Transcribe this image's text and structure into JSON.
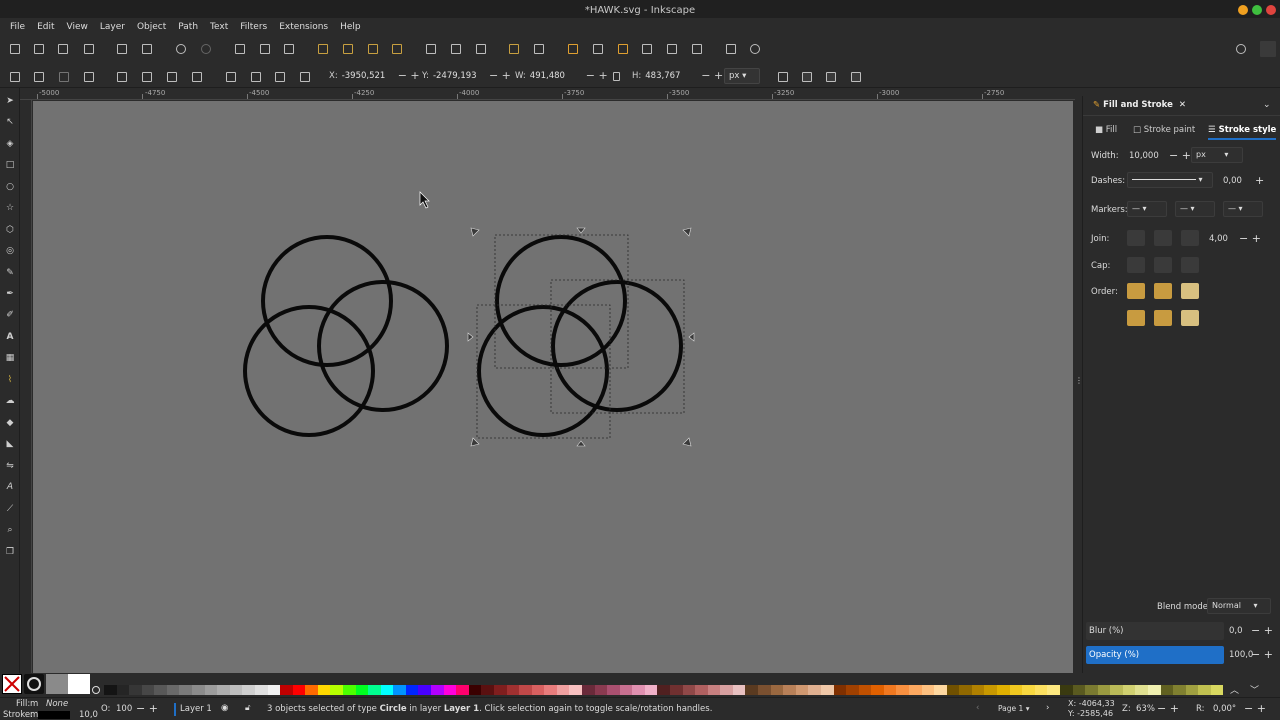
{
  "window": {
    "title": "*HAWK.svg - Inkscape"
  },
  "menu": [
    "File",
    "Edit",
    "View",
    "Layer",
    "Object",
    "Path",
    "Text",
    "Filters",
    "Extensions",
    "Help"
  ],
  "controls": {
    "x_label": "X:",
    "x_value": "-3950,521",
    "y_label": "Y:",
    "y_value": "-2479,193",
    "w_label": "W:",
    "w_value": "491,480",
    "h_label": "H:",
    "h_value": "483,767",
    "unit": "px"
  },
  "ruler": {
    "labels": [
      "-5000",
      "-4750",
      "-4500",
      "-4250",
      "-4000",
      "-3750",
      "-3500",
      "-3250",
      "-3000",
      "-2750"
    ]
  },
  "dock": {
    "panel_title": "Fill and Stroke",
    "tabs": [
      "Fill",
      "Stroke paint",
      "Stroke style"
    ],
    "width_label": "Width:",
    "width_value": "10,000",
    "width_unit": "px",
    "dashes_label": "Dashes:",
    "dashes_value": "0,00",
    "markers_label": "Markers:",
    "join_label": "Join:",
    "join_value": "4,00",
    "cap_label": "Cap:",
    "order_label": "Order:",
    "blend_label": "Blend mode:",
    "blend_value": "Normal",
    "blur_label": "Blur (%)",
    "blur_value": "0,0",
    "opacity_label": "Opacity (%)",
    "opacity_value": "100,0"
  },
  "status": {
    "fill_label": "Fill:",
    "fill_value": "m",
    "stroke_label": "Stroke:",
    "stroke_value": "m",
    "fill_none": "None",
    "stroke_width": "10,0",
    "opacity_label": "O:",
    "opacity_value": "100",
    "layer": "Layer 1",
    "message_prefix": "3 objects selected of type ",
    "message_type": "Circle",
    "message_mid": " in layer ",
    "message_layer": "Layer 1",
    "message_suffix": ". Click selection again to toggle scale/rotation handles.",
    "page": "Page 1",
    "cursor_x": "X: -4064,33",
    "cursor_y": "Y: -2585,46",
    "zoom_label": "Z:",
    "zoom": "63%",
    "rotation_label": "R:",
    "rotation": "0,00°"
  },
  "colors": {
    "canvas": "#727272",
    "accent": "#1f6fc7",
    "chrome": "#2b2b2b"
  }
}
